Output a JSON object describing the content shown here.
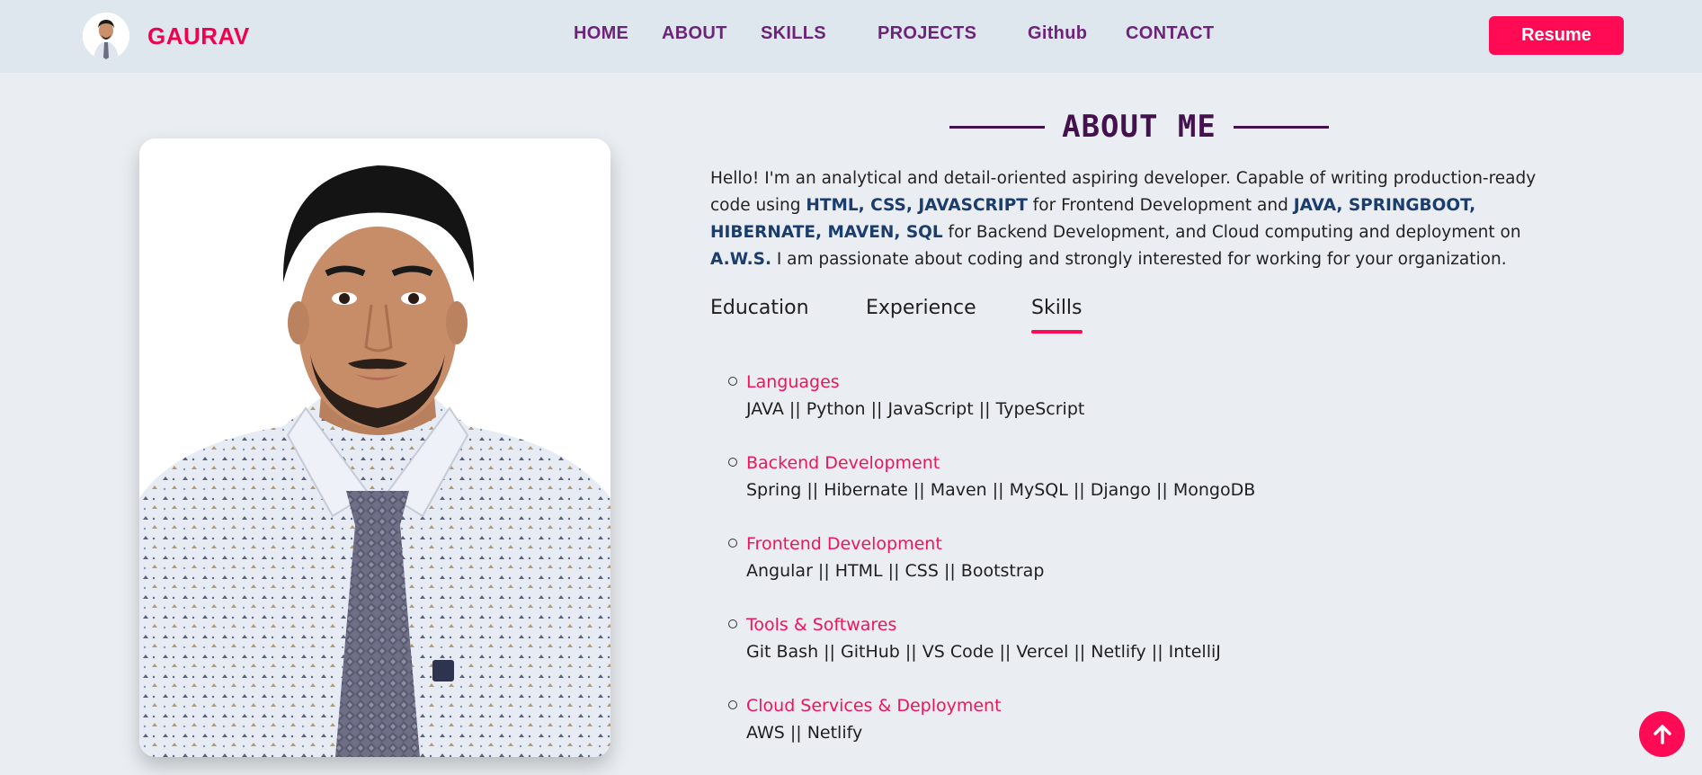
{
  "nav": {
    "brand": "GAURAV",
    "links": [
      "HOME",
      "ABOUT",
      "SKILLS",
      "PROJECTS",
      "Github",
      "CONTACT"
    ],
    "resume_label": "Resume"
  },
  "about": {
    "heading": "ABOUT ME",
    "intro": {
      "p1": "Hello! I'm an analytical and detail-oriented aspiring developer. Capable of writing production-ready code using ",
      "b1": "HTML, CSS, JAVASCRIPT",
      "p2": " for Frontend Development and ",
      "b2": "JAVA, SPRINGBOOT, HIBERNATE, MAVEN, SQL",
      "p3": " for Backend Development, and Cloud computing and deployment on ",
      "b3": "A.W.S.",
      "p4": " I am passionate about coding and strongly interested for working for your organization."
    },
    "tabs": [
      "Education",
      "Experience",
      "Skills"
    ],
    "active_tab": "Skills",
    "skills": [
      {
        "title": "Languages",
        "items": "JAVA || Python || JavaScript || TypeScript"
      },
      {
        "title": "Backend Development",
        "items": "Spring || Hibernate || Maven || MySQL || Django || MongoDB"
      },
      {
        "title": "Frontend Development",
        "items": "Angular || HTML || CSS || Bootstrap"
      },
      {
        "title": "Tools & Softwares",
        "items": "Git Bash || GitHub || VS Code || Vercel || Netlify || IntelliJ"
      },
      {
        "title": "Cloud Services & Deployment",
        "items": "AWS || Netlify"
      }
    ]
  },
  "icons": {
    "scroll_top": "arrow-up-icon",
    "avatar": "profile-avatar"
  },
  "colors": {
    "accent": "#ff0a55",
    "nav_link": "#6b2478",
    "heading": "#44114f",
    "highlight": "#1b3d6e"
  }
}
